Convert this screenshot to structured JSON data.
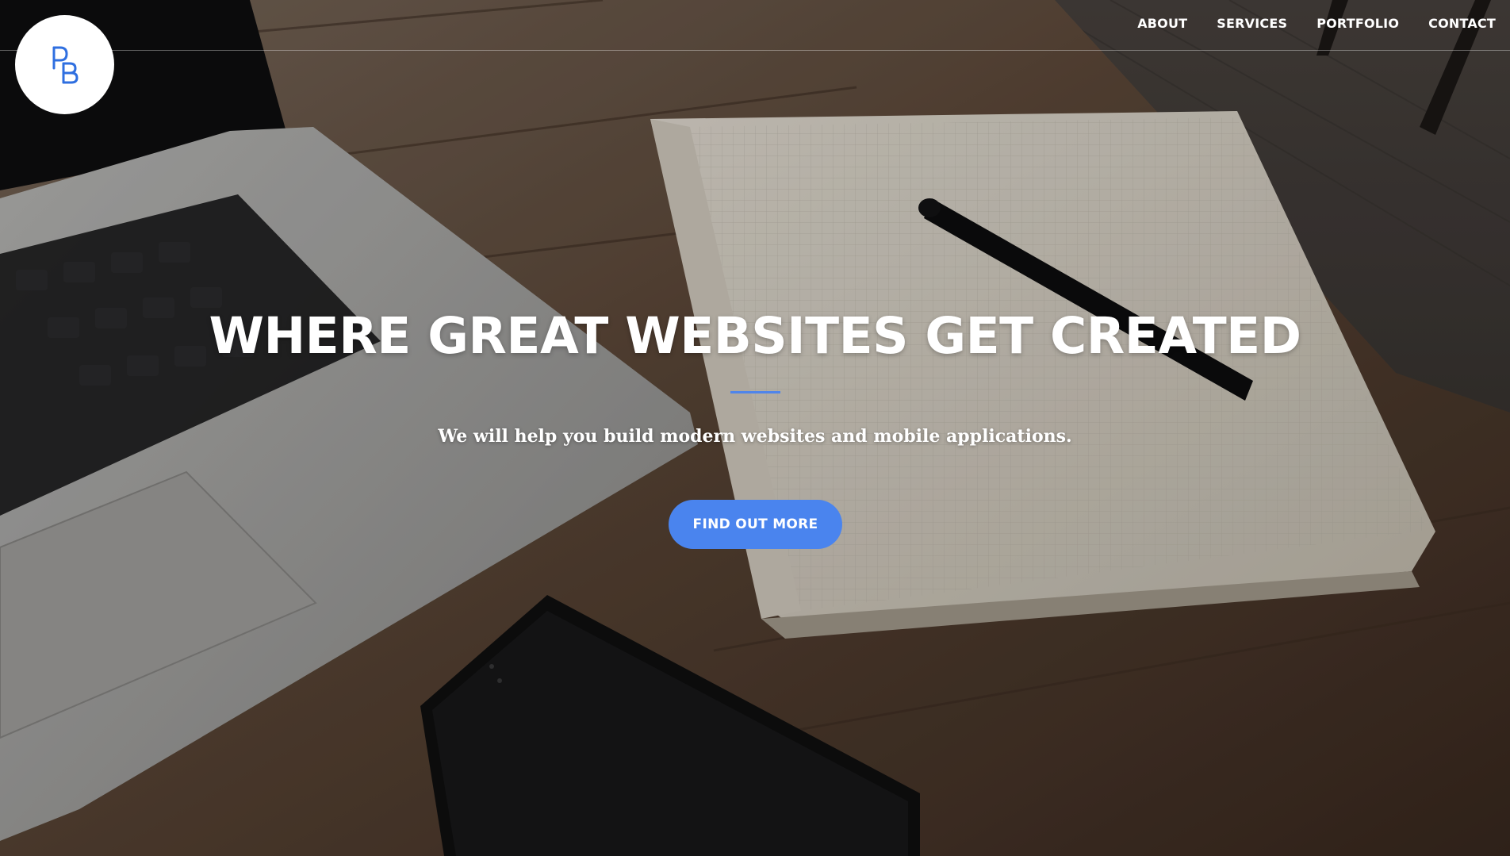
{
  "logo": {
    "alt_label": "PB",
    "accent_color": "#2f6fe0"
  },
  "nav": {
    "items": [
      {
        "label": "ABOUT"
      },
      {
        "label": "SERVICES"
      },
      {
        "label": "PORTFOLIO"
      },
      {
        "label": "CONTACT"
      }
    ]
  },
  "hero": {
    "headline": "WHERE GREAT WEBSITES GET CREATED",
    "subheadline": "We will help you build modern websites and mobile applications.",
    "cta_label": "FIND OUT MORE",
    "accent_color": "#4a84ee"
  }
}
